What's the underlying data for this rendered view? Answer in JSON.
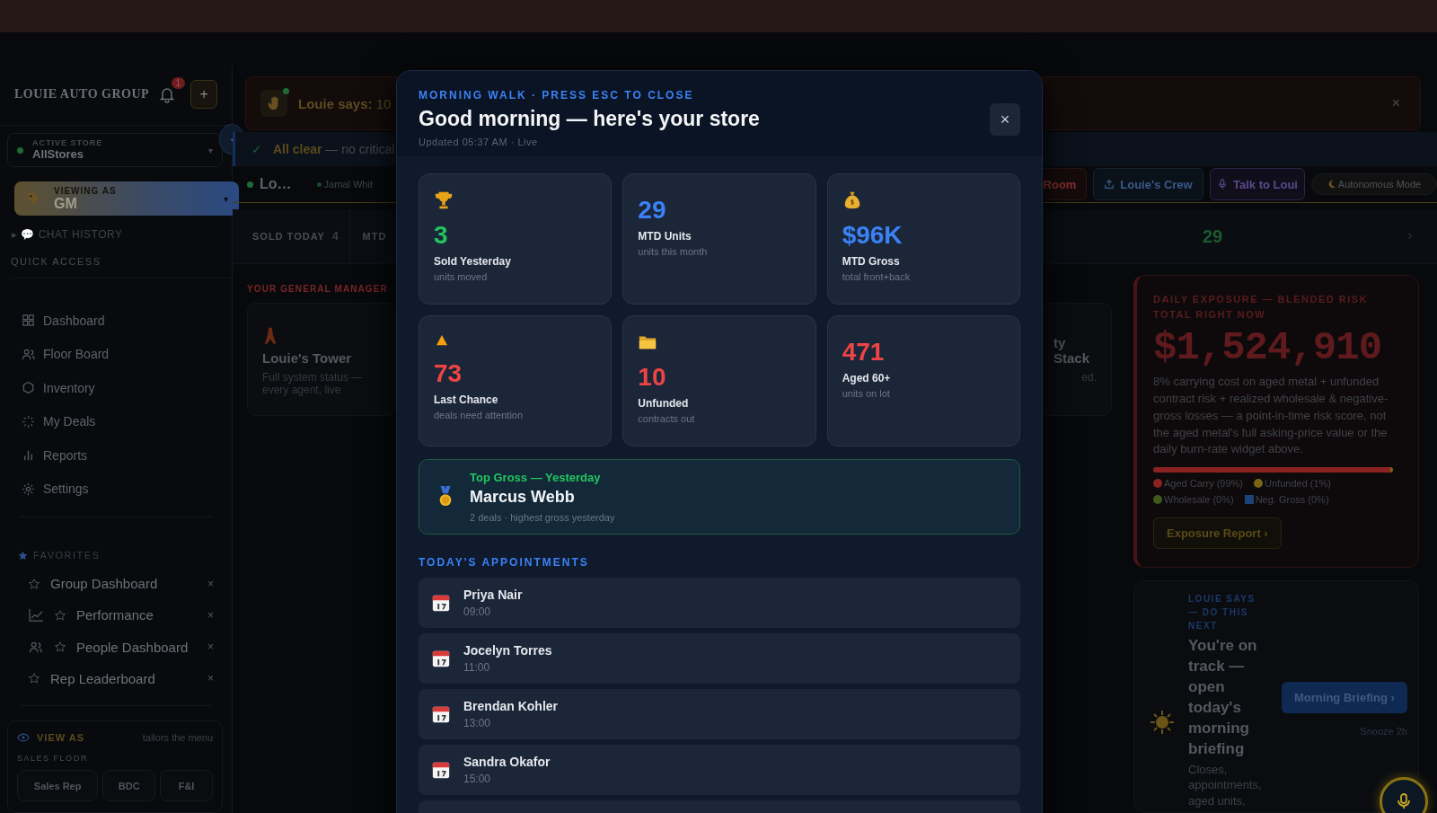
{
  "sidebar": {
    "brand": "LOUIE AUTO GROUP",
    "notification_count": "1",
    "add_label": "+",
    "active_store": {
      "label": "ACTIVE STORE",
      "value": "AllStores",
      "caret": "▾"
    },
    "viewing_as": {
      "label": "VIEWING AS",
      "value": "GM",
      "caret": "▾"
    },
    "chat_history": {
      "arrow": "▸",
      "label": "💬 CHAT HISTORY",
      "expanded": false
    },
    "quick_access_title": "QUICK ACCESS",
    "nav": [
      {
        "label": "Dashboard",
        "kind": "grid"
      },
      {
        "label": "Floor Board",
        "kind": "users"
      },
      {
        "label": "Inventory",
        "kind": "hexagon"
      },
      {
        "label": "My Deals",
        "kind": "spinner"
      },
      {
        "label": "Reports",
        "kind": "bars"
      },
      {
        "label": "Settings",
        "kind": "gear"
      }
    ],
    "favorites_title": "FAVORITES",
    "favorites": [
      {
        "label": "Group Dashboard",
        "kind": "plain",
        "remove": "×"
      },
      {
        "label": "Performance",
        "kind": "chart",
        "remove": "×"
      },
      {
        "label": "People Dashboard",
        "kind": "users",
        "remove": "×"
      },
      {
        "label": "Rep Leaderboard",
        "kind": "plain",
        "remove": "×"
      }
    ],
    "view_as": {
      "title": "VIEW AS",
      "hint": "tailors the menu",
      "group": "SALES FLOOR",
      "options": [
        {
          "label": "Sales Rep",
          "selected": false
        },
        {
          "label": "BDC",
          "selected": false
        },
        {
          "label": "F&I",
          "selected": false
        }
      ]
    }
  },
  "banner": {
    "speaker": "Louie says:",
    "text": "10",
    "close": "×"
  },
  "status_bar": {
    "mark": "✓",
    "title": "All clear",
    "text": "— no critical"
  },
  "toolbar": {
    "store_chip": "Lo…",
    "rep_chip": "Jamal Whit",
    "buttons": [
      {
        "label": "Room",
        "kind": "danger"
      },
      {
        "label": "Louie's Crew",
        "kind": "crew"
      },
      {
        "label": "Talk to Loui",
        "kind": "talk"
      }
    ],
    "autonomous": {
      "label": "Autonomous Mode",
      "on": false
    }
  },
  "stats": [
    {
      "label": "SOLD TODAY",
      "value": "4"
    },
    {
      "label": "MTD"
    }
  ],
  "stats_right_value": "29",
  "gm_section": {
    "title": "YOUR GENERAL MANAGER",
    "cards": [
      {
        "kind": "tower",
        "title": "Louie's Tower",
        "text": "Full system status — every agent, live"
      }
    ],
    "right_card": {
      "title": "ty Stack",
      "text": "ed."
    }
  },
  "exposure": {
    "label": "DAILY EXPOSURE — BLENDED RISK TOTAL RIGHT NOW",
    "amount": "$1,524,910",
    "text": "8% carrying cost on aged metal + unfunded contract risk + realized wholesale & negative-gross losses — a point-in-time risk score, not the aged metal's full asking-price value or the daily burn-rate widget above.",
    "legend": [
      {
        "label": "Aged Carry (99%)",
        "color": "#8a2222",
        "level": 0.99
      },
      {
        "label": "Unfunded (1%)",
        "color": "#7a6418",
        "level": 0.01
      },
      {
        "label": "Wholesale (0%)",
        "color": "#3d5a1a"
      },
      {
        "label": "Neg. Gross (0%)",
        "color": "#1a4478"
      }
    ],
    "button": "Exposure Report ›"
  },
  "next_step": {
    "label": "LOUIE SAYS — DO THIS NEXT",
    "title": "You're on track — open today's morning briefing",
    "text": "Closes, appointments, aged units,",
    "button": "Morning Briefing ›",
    "snooze": "Snooze 2h"
  },
  "modal": {
    "eyebrow": "MORNING WALK · PRESS ESC TO CLOSE",
    "title": "Good morning — here's your store",
    "updated": "Updated 05:37 AM · Live",
    "close": "×",
    "cards": [
      {
        "kind": "trophy",
        "value": "3",
        "color": "#22c55e",
        "label": "Sold Yesterday",
        "sub": "units moved"
      },
      {
        "kind": "plain",
        "value": "29",
        "color": "#3b82f6",
        "label": "MTD Units",
        "sub": "units this month"
      },
      {
        "kind": "moneybag",
        "value": "$96K",
        "color": "#3b82f6",
        "label": "MTD Gross",
        "sub": "total front+back"
      },
      {
        "kind": "warning",
        "value": "73",
        "color": "#ef4444",
        "label": "Last Chance",
        "sub": "deals need attention"
      },
      {
        "kind": "folder",
        "value": "10",
        "color": "#ef4444",
        "label": "Unfunded",
        "sub": "contracts out"
      },
      {
        "kind": "plain",
        "value": "471",
        "color": "#ef4444",
        "label": "Aged 60+",
        "sub": "units on lot"
      }
    ],
    "top_gross": {
      "label": "Top Gross — Yesterday",
      "name": "Marcus Webb",
      "text": "2 deals · highest gross yesterday"
    },
    "appointments_title": "TODAY'S APPOINTMENTS",
    "appointments": [
      {
        "name": "Priya Nair",
        "time": "09:00"
      },
      {
        "name": "Jocelyn Torres",
        "time": "11:00"
      },
      {
        "name": "Brendan Kohler",
        "time": "13:00"
      },
      {
        "name": "Sandra Okafor",
        "time": "15:00"
      }
    ]
  }
}
